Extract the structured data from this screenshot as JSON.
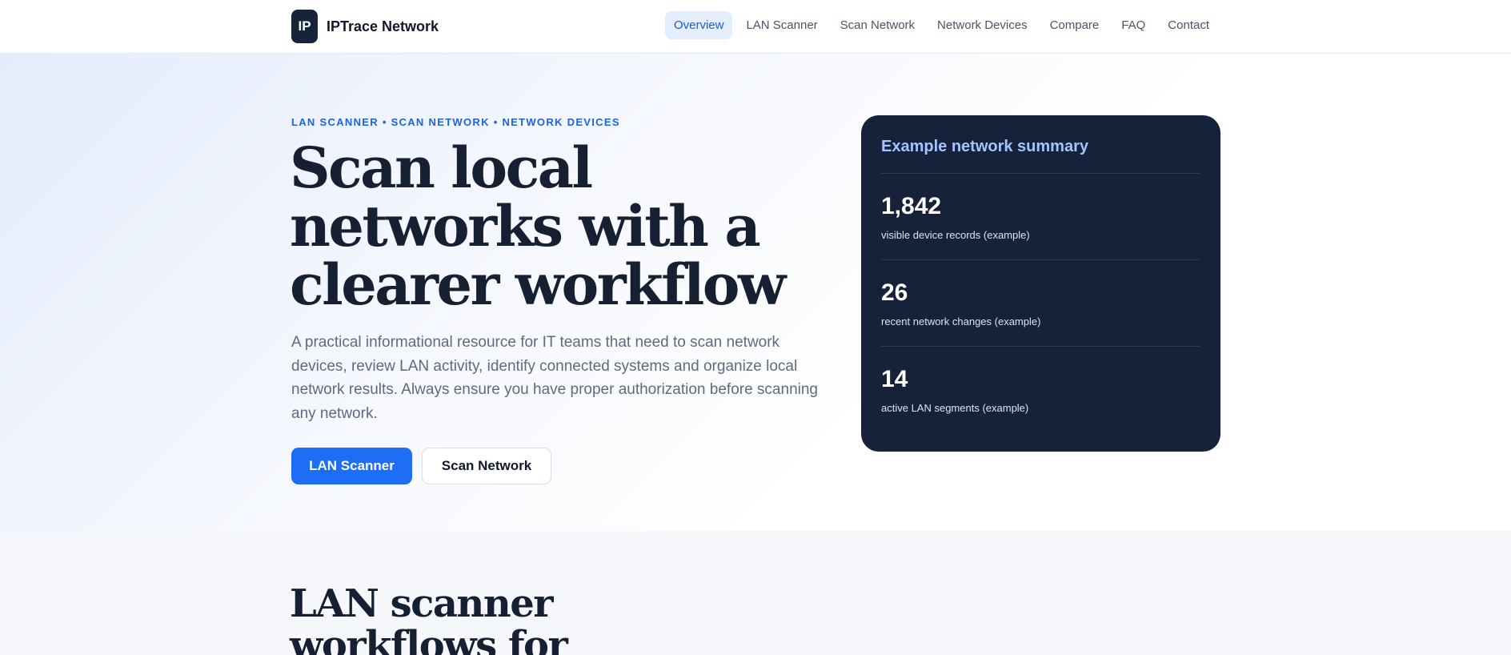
{
  "brand": {
    "logo_text": "IP",
    "name": "IPTrace Network"
  },
  "nav": {
    "items": [
      {
        "label": "Overview",
        "active": true
      },
      {
        "label": "LAN Scanner",
        "active": false
      },
      {
        "label": "Scan Network",
        "active": false
      },
      {
        "label": "Network Devices",
        "active": false
      },
      {
        "label": "Compare",
        "active": false
      },
      {
        "label": "FAQ",
        "active": false
      },
      {
        "label": "Contact",
        "active": false
      }
    ]
  },
  "hero": {
    "eyebrow": "LAN SCANNER • SCAN NETWORK • NETWORK DEVICES",
    "title": "Scan local networks with a clearer workflow",
    "description": "A practical informational resource for IT teams that need to scan network devices, review LAN activity, identify connected systems and organize local network results. Always ensure you have proper authorization before scanning any network.",
    "primary_button": "LAN Scanner",
    "secondary_button": "Scan Network"
  },
  "summary_card": {
    "title": "Example network summary",
    "stats": [
      {
        "value": "1,842",
        "label": "visible device records (example)"
      },
      {
        "value": "26",
        "label": "recent network changes (example)"
      },
      {
        "value": "14",
        "label": "active LAN segments (example)"
      }
    ]
  },
  "section": {
    "title": "LAN scanner workflows for"
  },
  "colors": {
    "accent": "#1d6ef5",
    "eyebrow": "#1d63e0",
    "card_bg": "#16223a",
    "card_title": "#a3c4ff",
    "heading": "#162033"
  }
}
